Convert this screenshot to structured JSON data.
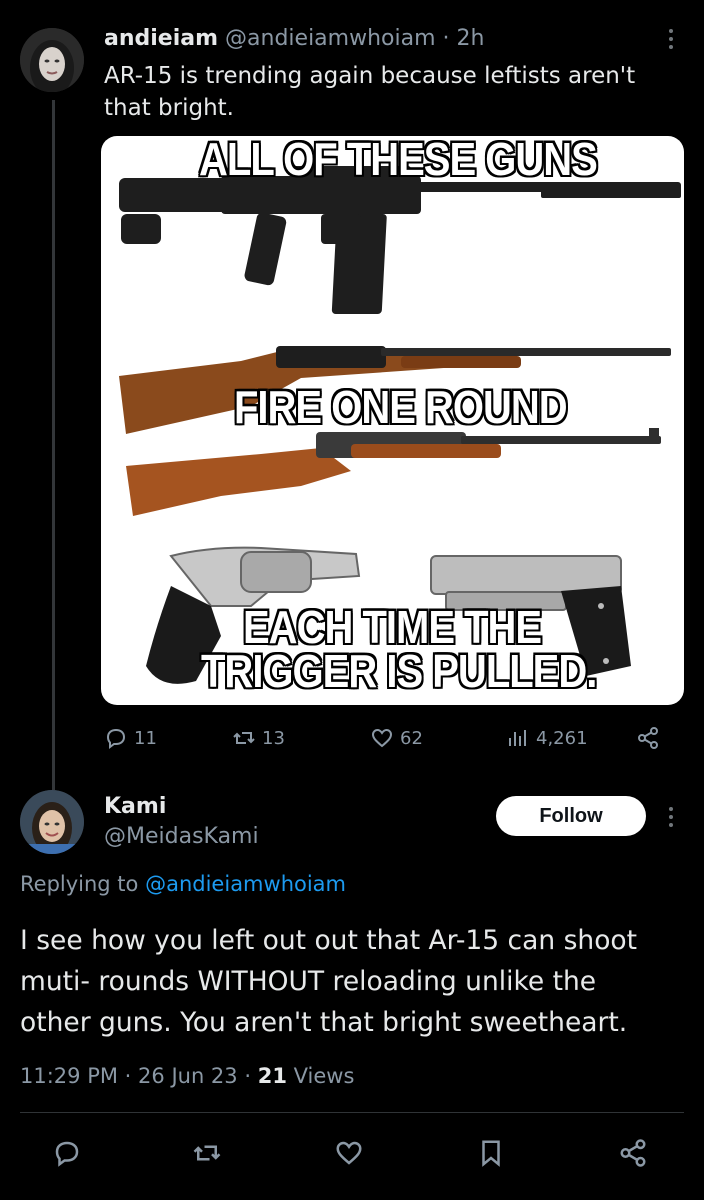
{
  "post": {
    "display_name": "andieiam",
    "handle": "@andieiamwhoiam",
    "separator": "·",
    "time": "2h",
    "text_line1": "AR-15 is trending again because leftists aren't",
    "text_line2": "that bright.",
    "meme": {
      "line1": "ALL OF THESE GUNS",
      "line2": "FIRE ONE ROUND",
      "line3": "EACH TIME THE",
      "line4": "TRIGGER IS PULLED."
    },
    "stats": {
      "replies": "11",
      "reposts": "13",
      "likes": "62",
      "views": "4,261"
    }
  },
  "reply": {
    "display_name": "Kami",
    "handle": "@MeidasKami",
    "follow_label": "Follow",
    "replying_prefix": "Replying to",
    "replying_handle": "@andieiamwhoiam",
    "text_line1": "I see how you left out out that Ar-15 can shoot",
    "text_line2": "muti- rounds WITHOUT reloading unlike the",
    "text_line3": "other guns. You aren't that bright sweetheart.",
    "time": "11:29 PM",
    "date": "26 Jun 23",
    "views_count": "21",
    "views_label": "Views"
  },
  "colors": {
    "background": "#000000",
    "text": "#e7e9ea",
    "muted": "#8b98a5",
    "link": "#1d9bf0",
    "divider": "#2f3336"
  }
}
